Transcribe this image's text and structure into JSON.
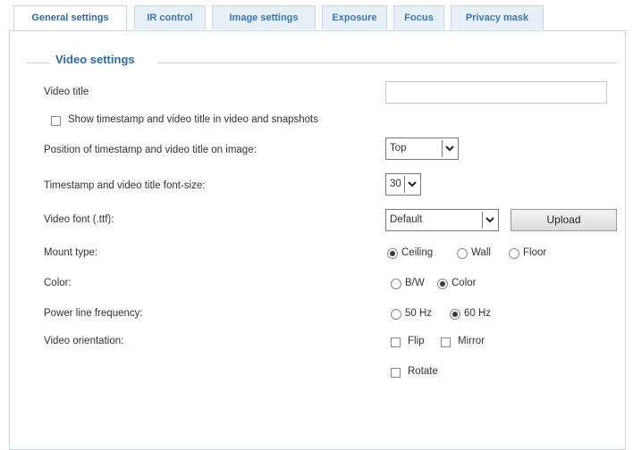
{
  "tabs": [
    {
      "label": "General settings",
      "active": true
    },
    {
      "label": "IR control",
      "active": false
    },
    {
      "label": "Image settings",
      "active": false
    },
    {
      "label": "Exposure",
      "active": false
    },
    {
      "label": "Focus",
      "active": false
    },
    {
      "label": "Privacy mask",
      "active": false
    }
  ],
  "section": {
    "title": "Video settings"
  },
  "fields": {
    "video_title": {
      "label": "Video title",
      "value": ""
    },
    "show_timestamp": {
      "label": "Show timestamp and video title in video and snapshots",
      "checked": false
    },
    "timestamp_position": {
      "label": "Position of timestamp and video title on image:",
      "value": "Top"
    },
    "font_size": {
      "label": "Timestamp and video title font-size:",
      "value": "30"
    },
    "video_font": {
      "label": "Video font (.ttf):",
      "value": "Default",
      "button": "Upload"
    },
    "mount_type": {
      "label": "Mount type:",
      "options": [
        "Ceiling",
        "Wall",
        "Floor"
      ],
      "selected": "Ceiling"
    },
    "color": {
      "label": "Color:",
      "options": [
        "B/W",
        "Color"
      ],
      "selected": "Color"
    },
    "power_line": {
      "label": "Power line frequency:",
      "options": [
        "50 Hz",
        "60 Hz"
      ],
      "selected": "60 Hz"
    },
    "orientation": {
      "label": "Video orientation:",
      "flip": "Flip",
      "mirror": "Mirror",
      "rotate": "Rotate"
    }
  }
}
